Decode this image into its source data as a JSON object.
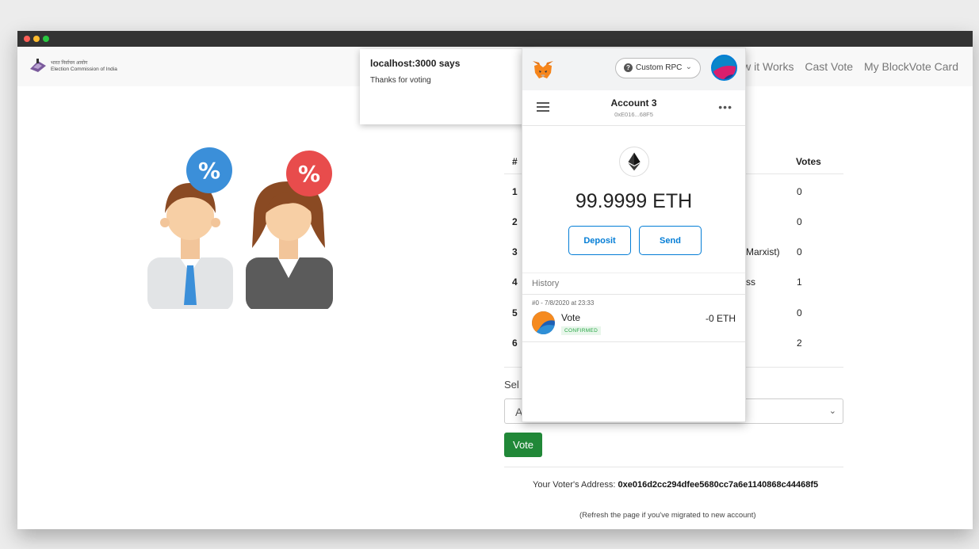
{
  "browser": {
    "brand_hindi": "भारत निर्वाचन आयोग",
    "brand_english": "Election Commission of India",
    "nav_links": [
      "How it Works",
      "Cast Vote",
      "My BlockVote Card"
    ]
  },
  "table": {
    "header_num": "#",
    "header_votes": "Votes",
    "rows": [
      {
        "num": "1",
        "name": "",
        "votes": "0"
      },
      {
        "num": "2",
        "name": "",
        "votes": "0"
      },
      {
        "num": "3",
        "name": "Marxist)",
        "votes": "0"
      },
      {
        "num": "4",
        "name": "ss",
        "votes": "1"
      },
      {
        "num": "5",
        "name": "",
        "votes": "0"
      },
      {
        "num": "6",
        "name": "",
        "votes": "2"
      }
    ]
  },
  "vote_form": {
    "select_label": "Sel",
    "select_value": "A",
    "vote_button": "Vote"
  },
  "footer": {
    "address_label": "Your Voter's Address: ",
    "address_value": "0xe016d2cc294dfee5680cc7a6e1140868c44468f5",
    "refresh_note": "(Refresh the page if you've migrated to new account)"
  },
  "alert": {
    "title": "localhost:3000 says",
    "message": "Thanks for voting"
  },
  "metamask": {
    "network": "Custom RPC",
    "account_name": "Account 3",
    "account_address": "0xE016...68F5",
    "balance": "99.9999 ETH",
    "deposit_button": "Deposit",
    "send_button": "Send",
    "history_label": "History",
    "transaction": {
      "date": "#0 - 7/8/2020 at 23:33",
      "title": "Vote",
      "status": "CONFIRMED",
      "amount": "-0 ETH"
    }
  },
  "icons": {
    "more": "more-icon",
    "chevron": "chevron-down-icon",
    "eth": "ethereum-icon",
    "help": "help-icon"
  },
  "colors": {
    "vote_green": "#218838",
    "metamask_blue": "#037dd6",
    "confirmed_green": "#28a745"
  }
}
